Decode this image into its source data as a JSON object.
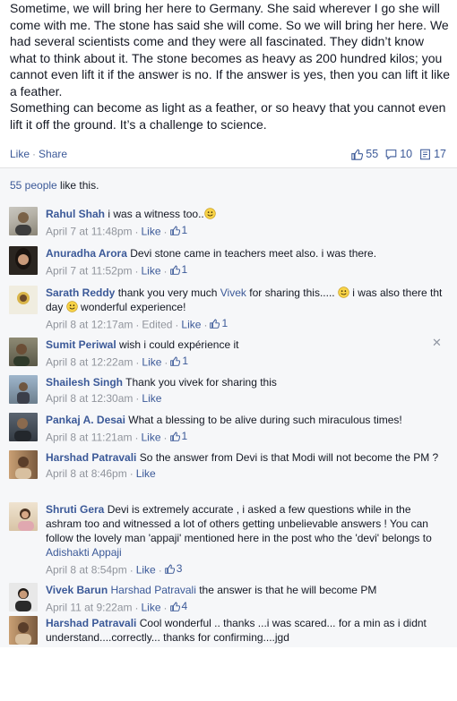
{
  "post": {
    "paragraphs": [
      "Sometime, we will bring her here to Germany. She said wherever I go she will come with me. The stone has said she will come. So we will bring her here. We had several scientists come and they were all fascinated. They didn’t know what to think about it. The stone becomes as heavy as 200 hundred kilos; you cannot even lift it if the answer is no. If the answer is yes, then you can lift it like a feather.",
      "Something can become as light as a feather, or so heavy that you cannot even lift it off the ground. It’s a challenge to science."
    ]
  },
  "actions": {
    "like": "Like",
    "separator": "·",
    "share": "Share",
    "likes_count": "55",
    "comments_count": "10",
    "shares_count": "17"
  },
  "likes_summary": {
    "link": "55 people",
    "rest": " like this."
  },
  "colors": {
    "link": "#3b5998",
    "meta": "#90949c",
    "comment_bg": "#f6f7f9"
  },
  "comments": [
    {
      "author": "Rahul Shah",
      "text": "i was a witness too..",
      "emoji": "smile",
      "time": "April 7 at 11:48pm",
      "like": "Like",
      "likes": "1"
    },
    {
      "author": "Anuradha Arora",
      "text": "Devi stone came in teachers meet also. i was there.",
      "time": "April 7 at 11:52pm",
      "like": "Like",
      "likes": "1"
    },
    {
      "author": "Sarath Reddy",
      "text_before": "thank you very much ",
      "mention": "Vivek",
      "text_after": " for sharing this..... ",
      "text_after2": " i was also there tht day ",
      "text_after3": " wonderful experience!",
      "time": "April 8 at 12:17am",
      "edited": "Edited",
      "like": "Like",
      "likes": "1"
    },
    {
      "author": "Sumit Periwal",
      "text": "wish i could expérience it",
      "time": "April 8 at 12:22am",
      "like": "Like",
      "likes": "1"
    },
    {
      "author": "Shailesh Singh",
      "text": "Thank you vivek for sharing this",
      "time": "April 8 at 12:30am",
      "like": "Like"
    },
    {
      "author": "Pankaj A. Desai",
      "text": "What a blessing to be alive during such miraculous times!",
      "time": "April 8 at 11:21am",
      "like": "Like",
      "likes": "1"
    },
    {
      "author": "Harshad Patravali",
      "text": "So the answer from Devi is that Modi will not become the PM ?",
      "time": "April 8 at 8:46pm",
      "like": "Like"
    },
    {
      "author": "Shruti Gera",
      "text": "Devi is extremely accurate , i asked a few questions while in the ashram too and witnessed a lot of others getting unbelievable answers ! You can follow the lovely man 'appaji' mentioned here in the post who the 'devi' belongs to ",
      "mention": "Adishakti Appaji",
      "time": "April 8 at 8:54pm",
      "like": "Like",
      "likes": "3"
    },
    {
      "author": "Vivek Barun",
      "mention": "Harshad Patravali",
      "text": " the answer is that he will become PM",
      "time": "April 11 at 9:22am",
      "like": "Like",
      "likes": "4"
    },
    {
      "author": "Harshad Patravali",
      "text": "Cool wonderful .. thanks ...i was scared... for a min as i didnt understand....correctly... thanks for confirming....jgd"
    }
  ],
  "icons": {
    "like": "thumbs-up-icon",
    "comment": "comment-bubble-icon",
    "share": "share-page-icon",
    "close": "close-icon"
  }
}
